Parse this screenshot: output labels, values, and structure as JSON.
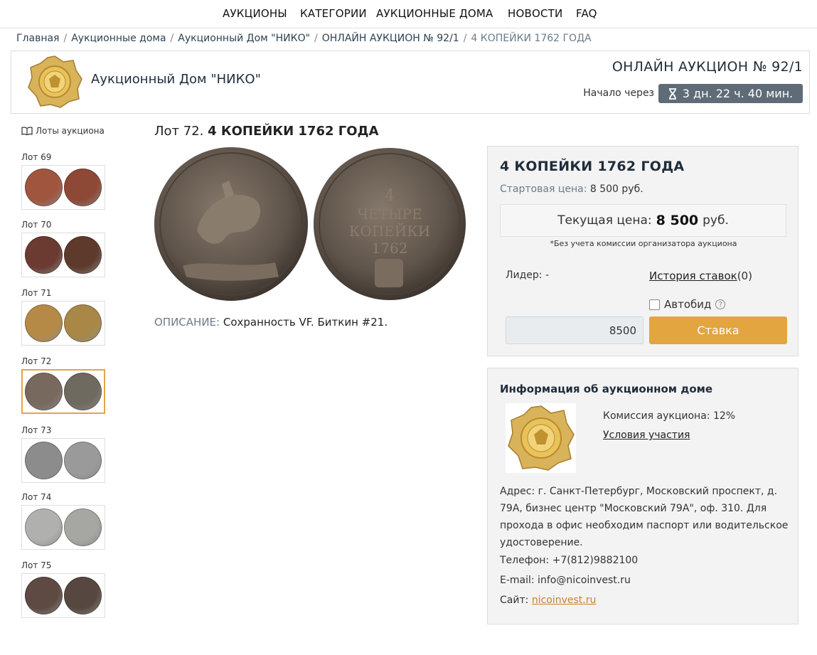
{
  "nav": {
    "items": [
      "АУКЦИОНЫ",
      "КАТЕГОРИИ",
      "АУКЦИОННЫЕ ДОМА",
      "НОВОСТИ",
      "FAQ"
    ]
  },
  "breadcrumb": {
    "items": [
      "Главная",
      "Аукционные дома",
      "Аукционный Дом \"НИКО\"",
      "ОНЛАЙН АУКЦИОН № 92/1",
      "4 КОПЕЙКИ 1762 ГОДА"
    ],
    "separator": "/"
  },
  "house": {
    "name": "Аукционный Дом \"НИКО\"",
    "auction_title": "ОНЛАЙН АУКЦИОН № 92/1",
    "start_label": "Начало через",
    "countdown": "3 дн. 22 ч. 40 мин.",
    "countdown_icon": "hourglass-icon"
  },
  "sidebar": {
    "header": "Лоты аукциона",
    "header_icon": "book-icon",
    "lots": [
      {
        "label": "Лот 69",
        "colors": [
          "#a0553f",
          "#8e4836"
        ],
        "active": false
      },
      {
        "label": "Лот 70",
        "colors": [
          "#6b3a30",
          "#5e3a2c"
        ],
        "active": false
      },
      {
        "label": "Лот 71",
        "colors": [
          "#b58a46",
          "#a98847"
        ],
        "active": false
      },
      {
        "label": "Лот 72",
        "colors": [
          "#77695d",
          "#6f6a60"
        ],
        "active": true
      },
      {
        "label": "Лот 73",
        "colors": [
          "#8c8c8c",
          "#9a9a9a"
        ],
        "active": false
      },
      {
        "label": "Лот 74",
        "colors": [
          "#b0b0ae",
          "#a6a6a3"
        ],
        "active": false
      },
      {
        "label": "Лот 75",
        "colors": [
          "#5e4a42",
          "#564740"
        ],
        "active": false
      }
    ]
  },
  "lot": {
    "prefix": "Лот 72.",
    "name": "4 КОПЕЙКИ 1762 ГОДА",
    "desc_label": "ОПИСАНИЕ:",
    "desc_text": "Сохранность VF. Биткин #21.",
    "coin_color": "#6a5d52"
  },
  "bid": {
    "title": "4 КОПЕЙКИ 1762 ГОДА",
    "start_label": "Стартовая цена:",
    "start_value": "8 500 руб.",
    "current_label": "Текущая цена:",
    "current_value": "8 500",
    "currency": "руб.",
    "commission_note": "*Без учета комиссии организатора аукциона",
    "leader": "Лидер: -",
    "history_link": "История ставок",
    "history_count": "(0)",
    "autobid_label": "Автобид",
    "input_value": "8500",
    "button_label": "Ставка",
    "accent": "#e2a540"
  },
  "info": {
    "title": "Информация об аукционном доме",
    "commission": "Комиссия аукциона: 12%",
    "terms_link": "Условия участия",
    "address": "Адрес: г. Санкт-Петербург, Московский проспект, д. 79А, бизнес центр \"Московский 79А\", оф. 310. Для прохода в офис необходим паспорт или водительское удостоверение.",
    "phone": "Телефон: +7(812)9882100",
    "email": "E-mail: info@nicoinvest.ru",
    "site_label": "Сайт:",
    "site_link": "nicoinvest.ru"
  }
}
